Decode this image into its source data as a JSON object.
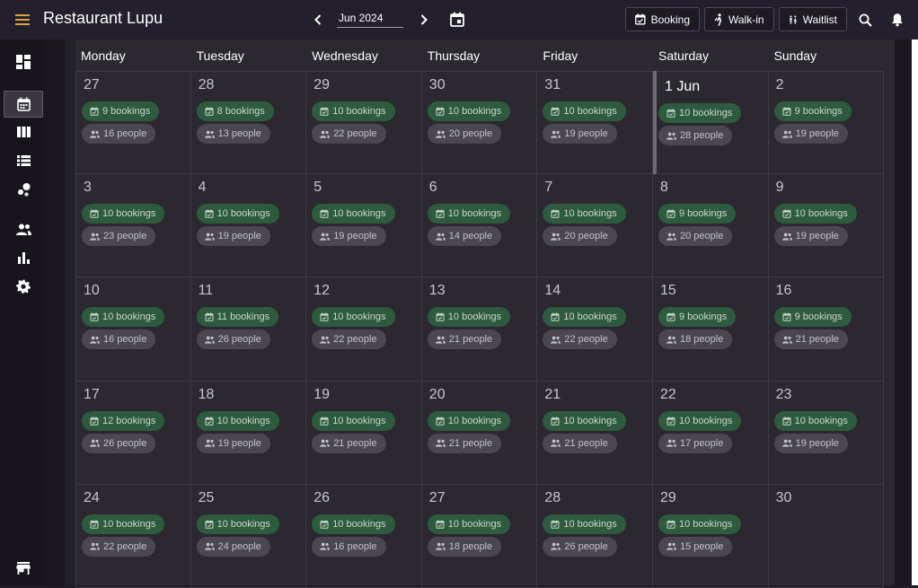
{
  "app": {
    "title": "Restaurant Lupu",
    "month": "Jun 2024",
    "buttons": {
      "booking": "Booking",
      "walkin": "Walk-in",
      "waitlist": "Waitlist"
    }
  },
  "sidebar": {
    "items": [
      {
        "name": "dashboard",
        "icon": "dashboard-icon"
      },
      {
        "name": "calendar",
        "icon": "calendar-icon",
        "active": true
      },
      {
        "name": "columns",
        "icon": "view-columns-icon"
      },
      {
        "name": "list",
        "icon": "view-list-icon"
      },
      {
        "name": "floor",
        "icon": "bubble-chart-icon"
      },
      {
        "name": "guests",
        "icon": "people-icon"
      },
      {
        "name": "reports",
        "icon": "bar-chart-icon"
      },
      {
        "name": "settings",
        "icon": "gear-icon"
      },
      {
        "name": "store",
        "icon": "store-icon"
      }
    ]
  },
  "weekdays": [
    "Monday",
    "Tuesday",
    "Wednesday",
    "Thursday",
    "Friday",
    "Saturday",
    "Sunday"
  ],
  "weeks": [
    [
      {
        "day": "27",
        "bookings": "9 bookings",
        "people": "16 people"
      },
      {
        "day": "28",
        "bookings": "8 bookings",
        "people": "13 people"
      },
      {
        "day": "29",
        "bookings": "10 bookings",
        "people": "22 people"
      },
      {
        "day": "30",
        "bookings": "10 bookings",
        "people": "20 people"
      },
      {
        "day": "31",
        "bookings": "10 bookings",
        "people": "19 people"
      },
      {
        "day": "1 Jun",
        "bookings": "10 bookings",
        "people": "28 people",
        "first": true
      },
      {
        "day": "2",
        "bookings": "9 bookings",
        "people": "19 people"
      }
    ],
    [
      {
        "day": "3",
        "bookings": "10 bookings",
        "people": "23 people"
      },
      {
        "day": "4",
        "bookings": "10 bookings",
        "people": "19 people"
      },
      {
        "day": "5",
        "bookings": "10 bookings",
        "people": "19 people"
      },
      {
        "day": "6",
        "bookings": "10 bookings",
        "people": "14 people"
      },
      {
        "day": "7",
        "bookings": "10 bookings",
        "people": "20 people"
      },
      {
        "day": "8",
        "bookings": "9 bookings",
        "people": "20 people"
      },
      {
        "day": "9",
        "bookings": "10 bookings",
        "people": "19 people"
      }
    ],
    [
      {
        "day": "10",
        "bookings": "10 bookings",
        "people": "16 people"
      },
      {
        "day": "11",
        "bookings": "11 bookings",
        "people": "26 people"
      },
      {
        "day": "12",
        "bookings": "10 bookings",
        "people": "22 people"
      },
      {
        "day": "13",
        "bookings": "10 bookings",
        "people": "21 people"
      },
      {
        "day": "14",
        "bookings": "10 bookings",
        "people": "22 people"
      },
      {
        "day": "15",
        "bookings": "9 bookings",
        "people": "18 people"
      },
      {
        "day": "16",
        "bookings": "9 bookings",
        "people": "21 people"
      }
    ],
    [
      {
        "day": "17",
        "bookings": "12 bookings",
        "people": "26 people"
      },
      {
        "day": "18",
        "bookings": "10 bookings",
        "people": "19 people"
      },
      {
        "day": "19",
        "bookings": "10 bookings",
        "people": "21 people"
      },
      {
        "day": "20",
        "bookings": "10 bookings",
        "people": "21 people"
      },
      {
        "day": "21",
        "bookings": "10 bookings",
        "people": "21 people"
      },
      {
        "day": "22",
        "bookings": "10 bookings",
        "people": "17 people"
      },
      {
        "day": "23",
        "bookings": "10 bookings",
        "people": "19 people"
      }
    ],
    [
      {
        "day": "24",
        "bookings": "10 bookings",
        "people": "22 people"
      },
      {
        "day": "25",
        "bookings": "10 bookings",
        "people": "24 people"
      },
      {
        "day": "26",
        "bookings": "10 bookings",
        "people": "16 people"
      },
      {
        "day": "27",
        "bookings": "10 bookings",
        "people": "18 people"
      },
      {
        "day": "28",
        "bookings": "10 bookings",
        "people": "26 people"
      },
      {
        "day": "29",
        "bookings": "10 bookings",
        "people": "15 people"
      },
      {
        "day": "30"
      }
    ]
  ],
  "colors": {
    "accent": "#e0a33a",
    "booking_chip": "#2e5a3f",
    "people_chip": "#4a4750"
  }
}
